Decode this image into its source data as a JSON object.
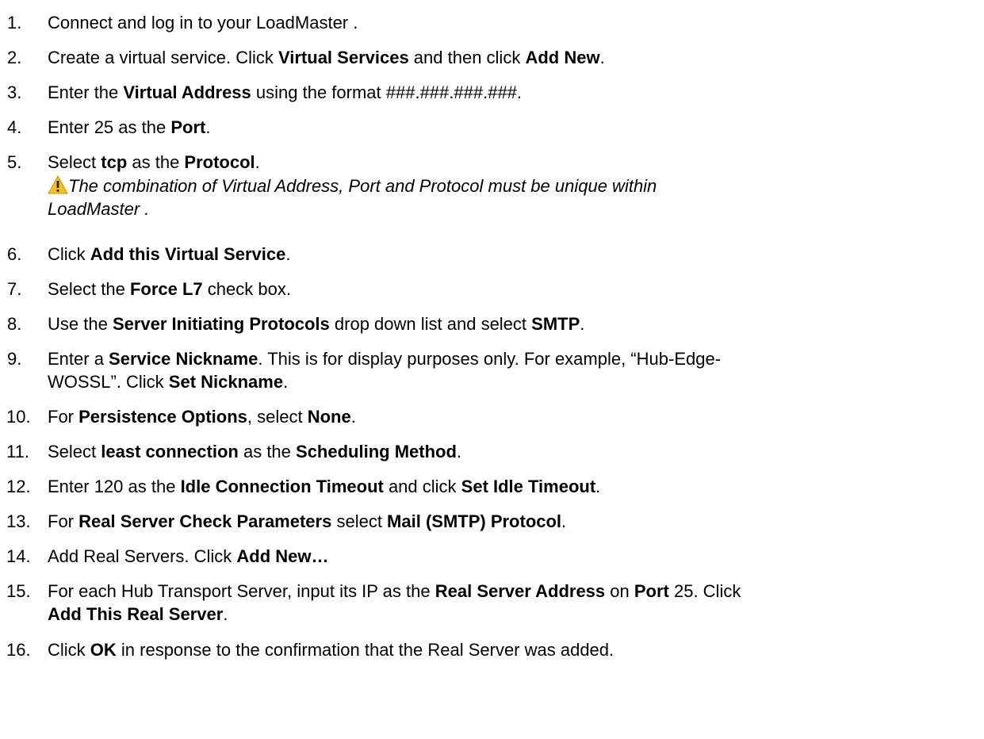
{
  "steps": [
    {
      "n": "1.",
      "parts": [
        "Connect and log in to your LoadMaster  ."
      ]
    },
    {
      "n": "2.",
      "parts": [
        "Create a virtual service. Click ",
        "Virtual Services",
        " and then click ",
        "Add New",
        "."
      ]
    },
    {
      "n": "3.",
      "parts": [
        "Enter the ",
        "Virtual Address",
        " using the format ###.###.###.###."
      ]
    },
    {
      "n": "4.",
      "parts": [
        "Enter 25 as the ",
        "Port",
        "."
      ]
    },
    {
      "n": "5.",
      "parts": [
        "Select ",
        "tcp",
        " as the ",
        "Protocol",
        "."
      ]
    },
    {
      "n": "6.",
      "parts": [
        "Click ",
        "Add this Virtual Service",
        "."
      ]
    },
    {
      "n": "7.",
      "parts": [
        "Select the ",
        "Force L7",
        " check box."
      ]
    },
    {
      "n": "8.",
      "parts": [
        "Use the ",
        "Server Initiating Protocols",
        " drop down list and select ",
        "SMTP",
        "."
      ]
    },
    {
      "n": "9.",
      "parts": [
        "Enter a ",
        "Service Nickname",
        ". This is for display purposes only. For example, “Hub-Edge-",
        "WOSSL”. Click ",
        "Set Nickname",
        "."
      ]
    },
    {
      "n": "10.",
      "parts": [
        "For ",
        "Persistence Options",
        ", select ",
        "None",
        "."
      ]
    },
    {
      "n": "11.",
      "parts": [
        "Select ",
        "least connection",
        " as the ",
        "Scheduling Method",
        "."
      ]
    },
    {
      "n": "12.",
      "parts": [
        "Enter 120 as the ",
        "Idle Connection Timeout",
        " and click ",
        "Set Idle Timeout",
        "."
      ]
    },
    {
      "n": "13.",
      "parts": [
        "For ",
        "Real Server Check Parameters",
        " select ",
        "Mail (SMTP) Protocol",
        "."
      ]
    },
    {
      "n": "14.",
      "parts": [
        "Add Real Servers. Click ",
        "Add New…"
      ]
    },
    {
      "n": "15.",
      "parts": [
        "For each Hub Transport Server, input its IP as the ",
        "Real Server Address",
        " on ",
        "Port",
        " 25. Click ",
        "Add This Real Server",
        "."
      ]
    },
    {
      "n": "16.",
      "parts": [
        "Click ",
        "OK",
        " in response to the confirmation that the Real Server was added."
      ]
    }
  ],
  "note": {
    "icon": "warning-icon",
    "line1": "The combination of Virtual Address, Port and Protocol must be unique within",
    "line2": "LoadMaster  ."
  }
}
